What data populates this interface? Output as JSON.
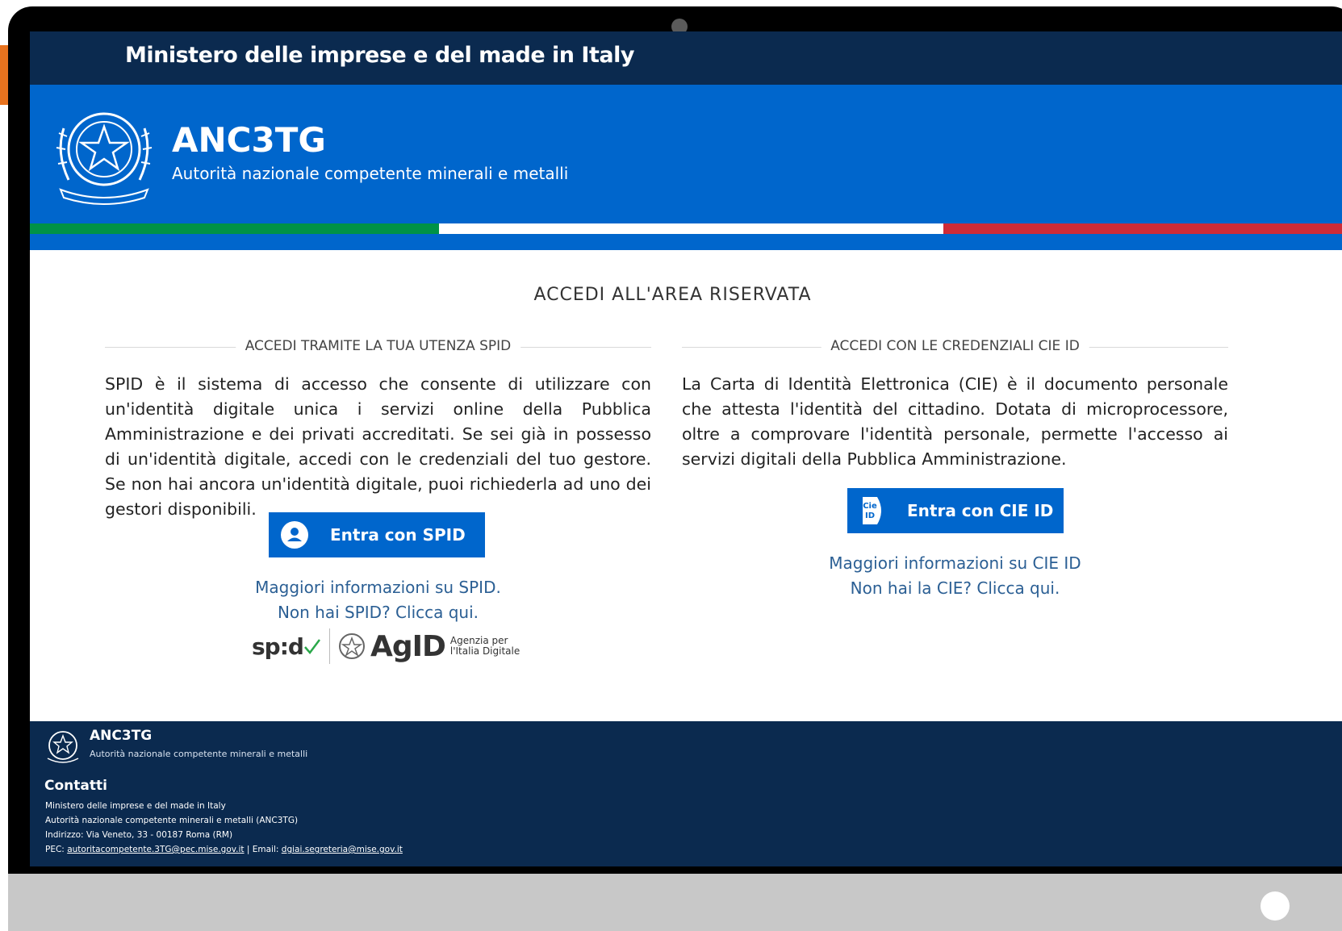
{
  "ministry": "Ministero delle imprese e del made in Italy",
  "app": {
    "name": "ANC3TG",
    "subtitle": "Autorità nazionale competente minerali e metalli"
  },
  "main_title": "ACCEDI ALL'AREA RISERVATA",
  "spid": {
    "heading": "ACCEDI TRAMITE LA TUA UTENZA SPID",
    "description": "SPID è il sistema di accesso che consente di utilizzare con un'identità digitale unica i servizi online della Pubblica Amministrazione e dei privati accreditati. Se sei già in possesso di un'identità digitale, accedi con le credenziali del tuo gestore. Se non hai ancora un'identità digitale, puoi richiederla ad uno dei gestori disponibili.",
    "button_label": "Entra con SPID",
    "info_link": "Maggiori informazioni su SPID.",
    "no_spid_link": "Non hai SPID? Clicca qui.",
    "logo_spid": "sp:d",
    "logo_agid": "AgID",
    "logo_agid_line1": "Agenzia per",
    "logo_agid_line2": "l'Italia Digitale"
  },
  "cie": {
    "heading": "ACCEDI CON LE CREDENZIALI CIE ID",
    "description": "La Carta di Identità Elettronica (CIE) è il documento personale che attesta l'identità del cittadino. Dotata di microprocessore, oltre a comprovare l'identità personale, permette l'accesso ai servizi digitali della Pubblica Amministrazione.",
    "button_label": "Entra con CIE ID",
    "icon_text_top": "Cie",
    "icon_text_bottom": "ID",
    "info_link": "Maggiori informazioni su CIE ID",
    "no_cie_link": "Non hai la CIE? Clicca qui."
  },
  "footer": {
    "name": "ANC3TG",
    "subtitle": "Autorità nazionale competente minerali e metalli",
    "contacts_title": "Contatti",
    "line1": "Ministero delle imprese e del made in Italy",
    "line2": "Autorità nazionale competente minerali e metalli (ANC3TG)",
    "line3": "Indirizzo: Via Veneto, 33 - 00187 Roma (RM)",
    "pec_label": "PEC:",
    "pec_email": "autoritacompetente.3TG@pec.mise.gov.it",
    "email_label": "| Email:",
    "email": "dgiai.segreteria@mise.gov.it"
  },
  "colors": {
    "navy": "#0b2a4f",
    "blue": "#0066cc",
    "link": "#2b5f94",
    "flag_green": "#009246",
    "flag_red": "#ce2b37"
  }
}
